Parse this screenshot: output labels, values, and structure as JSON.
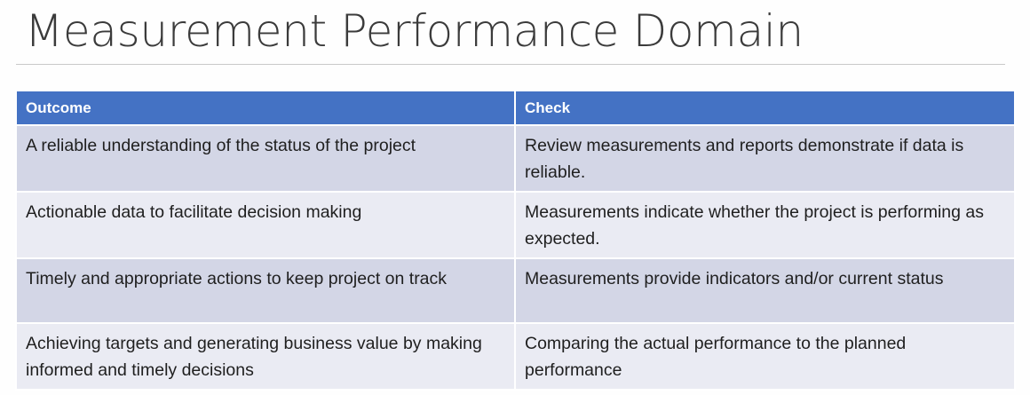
{
  "slide": {
    "title": "Measurement Performance Domain"
  },
  "table": {
    "headers": [
      "Outcome",
      "Check"
    ],
    "rows": [
      {
        "outcome": "A reliable understanding of the status of the project",
        "check": "Review measurements and reports demonstrate if data is reliable."
      },
      {
        "outcome": "Actionable data to facilitate decision making",
        "check": "Measurements indicate whether the project is performing as expected."
      },
      {
        "outcome": "Timely and appropriate actions to keep project on track",
        "check": "Measurements provide indicators and/or current status"
      },
      {
        "outcome": "Achieving targets and generating business value by making informed and timely decisions",
        "check": "Comparing the actual performance to the planned performance"
      }
    ]
  },
  "colors": {
    "header_bg": "#4472c4",
    "row_band_dark": "#d3d6e6",
    "row_band_light": "#eaebf3",
    "title_text": "#3b3b3b"
  }
}
